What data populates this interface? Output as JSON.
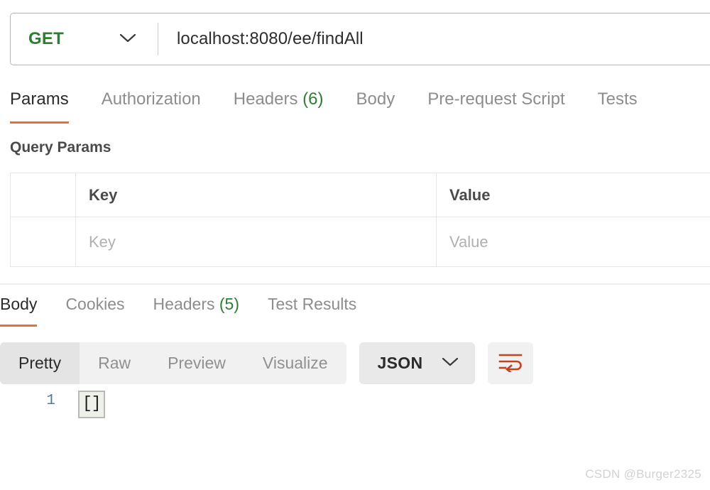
{
  "request_bar": {
    "method": "GET",
    "method_caret_icon": "chevron-down-icon",
    "url": "localhost:8080/ee/findAll",
    "url_placeholder": "Enter request URL"
  },
  "request_tabs": [
    {
      "label": "Params",
      "count": "",
      "active": true
    },
    {
      "label": "Authorization",
      "count": "",
      "active": false
    },
    {
      "label": "Headers",
      "count": "(6)",
      "active": false
    },
    {
      "label": "Body",
      "count": "",
      "active": false
    },
    {
      "label": "Pre-request Script",
      "count": "",
      "active": false
    },
    {
      "label": "Tests",
      "count": "",
      "active": false
    }
  ],
  "query_params": {
    "section_title": "Query Params",
    "columns": [
      "",
      "Key",
      "Value"
    ],
    "rows": [
      {
        "check": "",
        "key": "",
        "key_placeholder": "Key",
        "value": "",
        "value_placeholder": "Value"
      }
    ]
  },
  "response_tabs": [
    {
      "label": "Body",
      "count": "",
      "active": true
    },
    {
      "label": "Cookies",
      "count": "",
      "active": false
    },
    {
      "label": "Headers",
      "count": "(5)",
      "active": false
    },
    {
      "label": "Test Results",
      "count": "",
      "active": false
    }
  ],
  "view_toolbar": {
    "segments": [
      {
        "label": "Pretty",
        "active": true
      },
      {
        "label": "Raw",
        "active": false
      },
      {
        "label": "Preview",
        "active": false
      },
      {
        "label": "Visualize",
        "active": false
      }
    ],
    "format": "JSON",
    "format_caret_icon": "chevron-down-icon",
    "wrap_icon": "word-wrap-icon"
  },
  "response_body": {
    "line_numbers": [
      "1"
    ],
    "lines": [
      "[]"
    ]
  },
  "watermark": "CSDN @Burger2325",
  "colors": {
    "accent_orange": "#ef6c37",
    "method_green": "#2e7d33",
    "count_green": "#2e7d33",
    "wrap_icon_orange": "#c0441e",
    "line_number_blue": "#527a96"
  }
}
